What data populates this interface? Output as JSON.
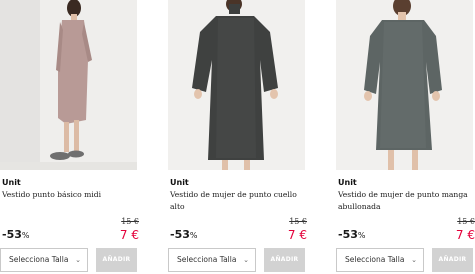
{
  "products": [
    {
      "brand": "Unit",
      "name": "Vestido punto básico midi",
      "old_price": "15 €",
      "discount": "-53",
      "discount_unit": "%",
      "price": "7 €",
      "size_placeholder": "Selecciona Talla",
      "add_label": "AÑADIR"
    },
    {
      "brand": "Unit",
      "name": "Vestido de mujer de punto cuello alto",
      "old_price": "15 €",
      "discount": "-53",
      "discount_unit": "%",
      "price": "7 €",
      "size_placeholder": "Selecciona Talla",
      "add_label": "AÑADIR"
    },
    {
      "brand": "Unit",
      "name": "Vestido de mujer de punto manga abullonada",
      "old_price": "15 €",
      "discount": "-53",
      "discount_unit": "%",
      "price": "7 €",
      "size_placeholder": "Selecciona Talla",
      "add_label": "AÑADIR"
    }
  ],
  "colors": {
    "price_red": "#e4003a",
    "button_grey": "#d2d2d2",
    "dress_pink": "#b89a96",
    "dress_charcoal": "#3f4140",
    "dress_slate": "#5d6564"
  }
}
